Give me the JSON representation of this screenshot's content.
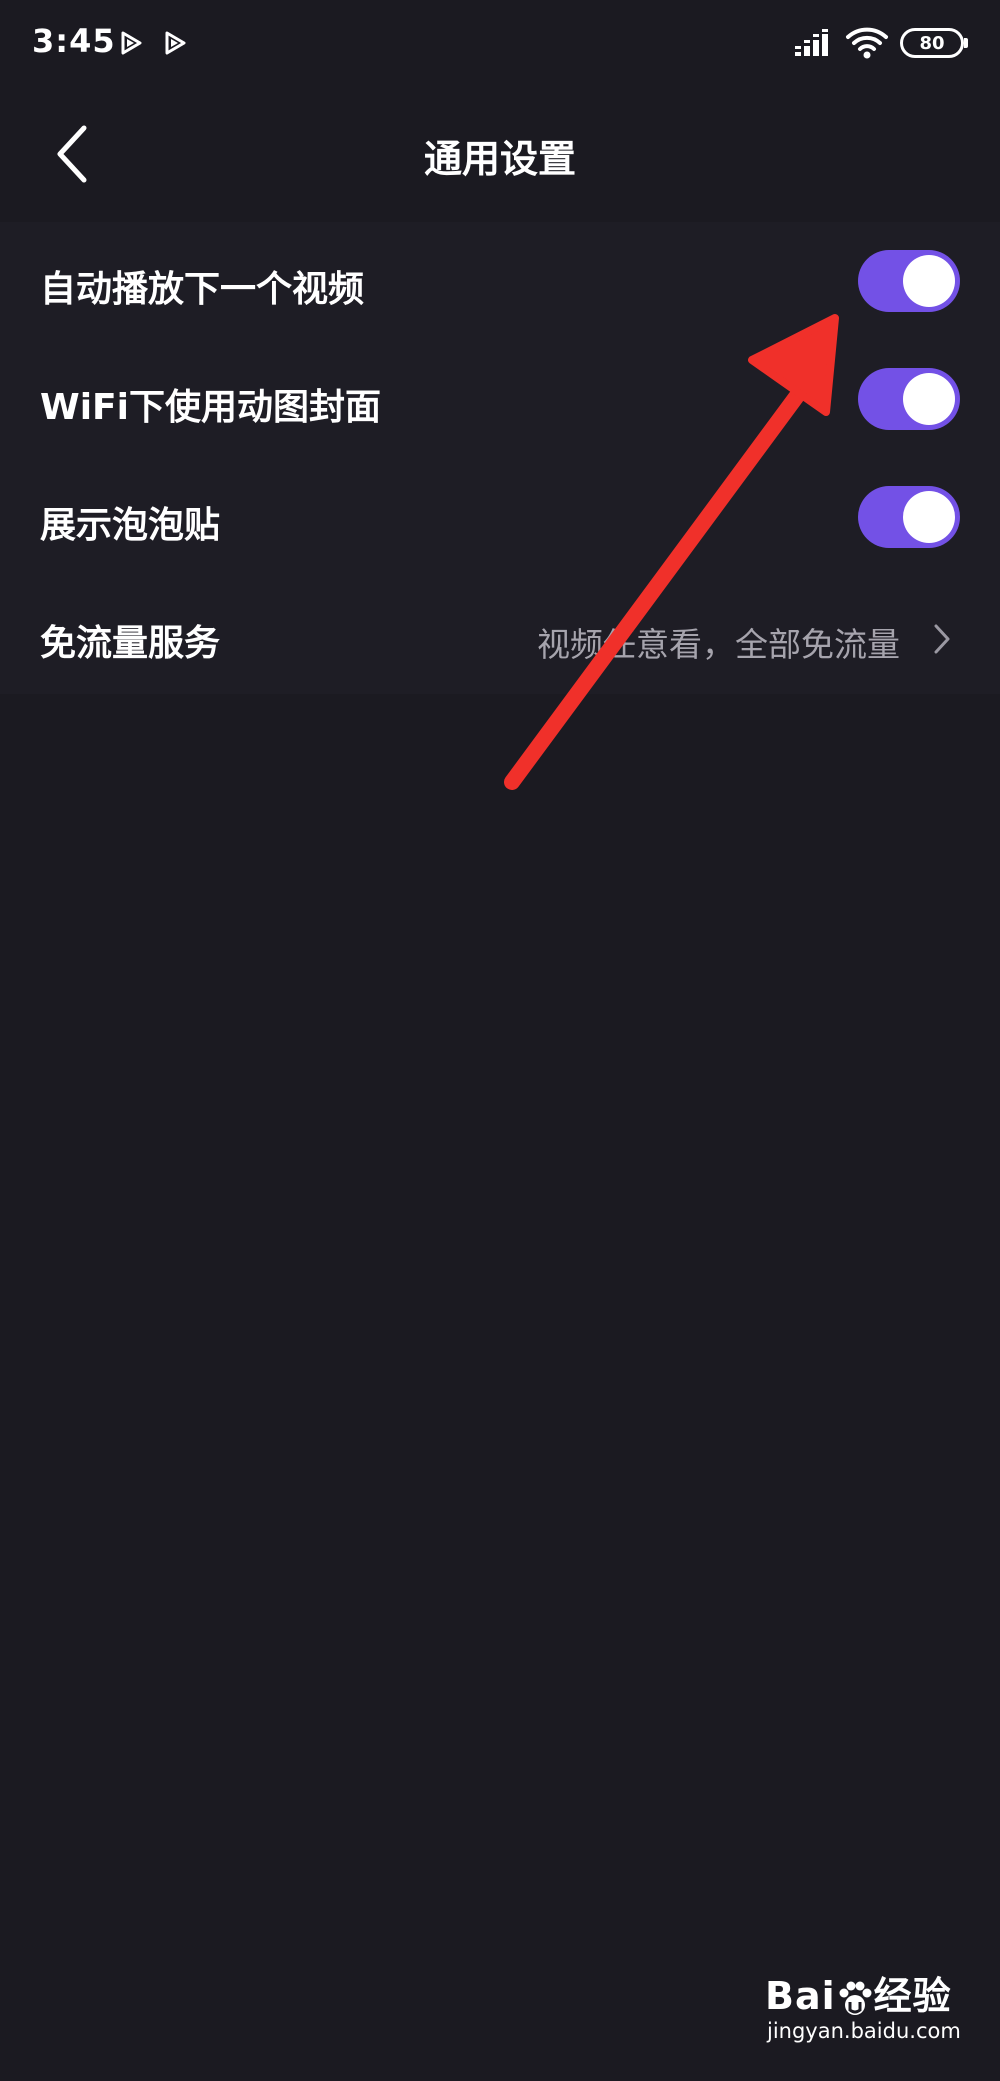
{
  "status_bar": {
    "time": "3:45",
    "battery": "80",
    "icons": [
      "play-icon",
      "play-icon",
      "signal-icon",
      "wifi-icon",
      "battery-icon"
    ]
  },
  "nav": {
    "title": "通用设置",
    "back_icon": "chevron-left-icon"
  },
  "settings": {
    "items": [
      {
        "label": "自动播放下一个视频",
        "type": "toggle",
        "on": true
      },
      {
        "label": "WiFi下使用动图封面",
        "type": "toggle",
        "on": true
      },
      {
        "label": "展示泡泡贴",
        "type": "toggle",
        "on": true
      },
      {
        "label": "免流量服务",
        "type": "link",
        "value": "视频任意看，全部免流量"
      }
    ]
  },
  "colors": {
    "background": "#1b1a21",
    "toggle_on": "#7351e6",
    "annotation_arrow": "#f0302a"
  },
  "watermark": {
    "logo_left": "Bai",
    "logo_right": "经验",
    "url": "jingyan.baidu.com"
  }
}
